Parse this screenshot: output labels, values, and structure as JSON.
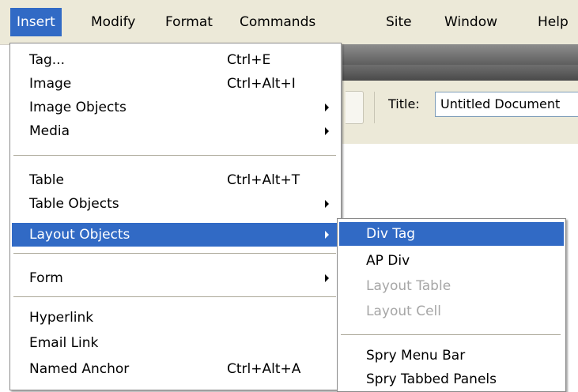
{
  "menubar": {
    "items": [
      {
        "label": "Insert"
      },
      {
        "label": "Modify"
      },
      {
        "label": "Format"
      },
      {
        "label": "Commands"
      },
      {
        "label": "Site"
      },
      {
        "label": "Window"
      },
      {
        "label": "Help"
      }
    ]
  },
  "toolbar": {
    "title_label": "Title:",
    "title_value": "Untitled Document"
  },
  "insert_menu": {
    "items": [
      {
        "label": "Tag...",
        "shortcut": "Ctrl+E"
      },
      {
        "label": "Image",
        "shortcut": "Ctrl+Alt+I"
      },
      {
        "label": "Image Objects",
        "has_submenu": true
      },
      {
        "label": "Media",
        "has_submenu": true
      },
      {
        "label": "Table",
        "shortcut": "Ctrl+Alt+T"
      },
      {
        "label": "Table Objects",
        "has_submenu": true
      },
      {
        "label": "Layout Objects",
        "has_submenu": true,
        "highlighted": true
      },
      {
        "label": "Form",
        "has_submenu": true
      },
      {
        "label": "Hyperlink"
      },
      {
        "label": "Email Link"
      },
      {
        "label": "Named Anchor",
        "shortcut": "Ctrl+Alt+A"
      }
    ]
  },
  "layout_submenu": {
    "items": [
      {
        "label": "Div Tag",
        "highlighted": true
      },
      {
        "label": "AP Div"
      },
      {
        "label": "Layout Table",
        "disabled": true
      },
      {
        "label": "Layout Cell",
        "disabled": true
      },
      {
        "label": "Spry Menu Bar"
      },
      {
        "label": "Spry Tabbed Panels"
      }
    ]
  },
  "colors": {
    "highlight": "#316ac5",
    "menubar_bg": "#ece9d8",
    "disabled_text": "#a6a6a6"
  }
}
